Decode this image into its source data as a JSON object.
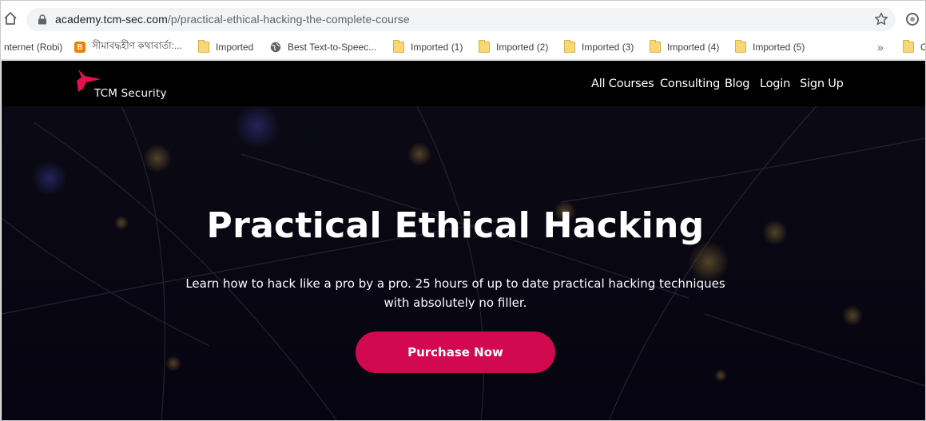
{
  "browser": {
    "url_host": "academy.tcm-sec.com",
    "url_path": "/p/practical-ethical-hacking-the-complete-course",
    "bookmarks": [
      {
        "label": "nternet (Robi)",
        "icon": "none"
      },
      {
        "label": "সীমাবদ্ধহীণ কথাবার্তা:...",
        "icon": "blogger-icon"
      },
      {
        "label": "Imported",
        "icon": "folder-icon"
      },
      {
        "label": "Best Text-to-Speec...",
        "icon": "globe-icon"
      },
      {
        "label": "Imported (1)",
        "icon": "folder-icon"
      },
      {
        "label": "Imported (2)",
        "icon": "folder-icon"
      },
      {
        "label": "Imported (3)",
        "icon": "folder-icon"
      },
      {
        "label": "Imported (4)",
        "icon": "folder-icon"
      },
      {
        "label": "Imported (5)",
        "icon": "folder-icon"
      },
      {
        "label": "O",
        "icon": "folder-icon"
      }
    ],
    "more_label": "»"
  },
  "site": {
    "logo_text": "TCM Security",
    "nav": [
      {
        "label": "All Courses"
      },
      {
        "label": "Consulting"
      },
      {
        "label": "Blog"
      },
      {
        "label": "Login"
      },
      {
        "label": "Sign Up"
      }
    ],
    "hero": {
      "title": "Practical Ethical Hacking",
      "subtitle_line1": "Learn how to hack like a pro by a pro. 25 hours of up to date practical hacking techniques",
      "subtitle_line2": "with absolutely no filler.",
      "cta_label": "Purchase Now"
    }
  },
  "colors": {
    "accent": "#d3094f",
    "site_background": "#000000",
    "logo": "#e3114f"
  }
}
